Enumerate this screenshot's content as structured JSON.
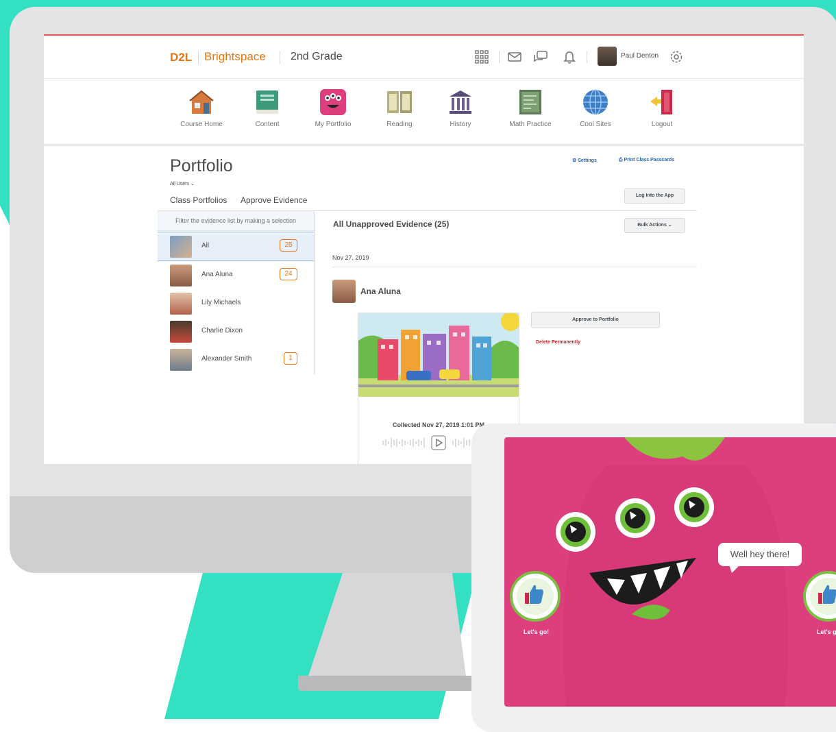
{
  "header": {
    "logo_d2l": "D2L",
    "logo_brightspace": "Brightspace",
    "course_name": "2nd Grade",
    "user_name": "Paul Denton",
    "icons": [
      "grid-icon",
      "mail-icon",
      "chat-icon",
      "bell-icon",
      "gear-icon"
    ]
  },
  "nav": {
    "items": [
      {
        "label": "Course Home",
        "icon": "house-icon"
      },
      {
        "label": "Content",
        "icon": "book-icon"
      },
      {
        "label": "My Portfolio",
        "icon": "monster-icon"
      },
      {
        "label": "Reading",
        "icon": "open-book-icon"
      },
      {
        "label": "History",
        "icon": "museum-icon"
      },
      {
        "label": "Math Practice",
        "icon": "chalkboard-icon"
      },
      {
        "label": "Cool Sites",
        "icon": "globe-icon"
      },
      {
        "label": "Logout",
        "icon": "door-icon"
      }
    ]
  },
  "page": {
    "title": "Portfolio",
    "user_filter": "All Users",
    "settings_link": "Settings",
    "print_link": "Print Class Passcards",
    "tabs": [
      "Class Portfolios",
      "Approve Evidence"
    ],
    "login_button": "Log Into the App"
  },
  "filter": {
    "heading": "Filter the evidence list by making a selection",
    "items": [
      {
        "name": "All",
        "count": "25",
        "selected": true
      },
      {
        "name": "Ana Aluna",
        "count": "24"
      },
      {
        "name": "Lily Michaels",
        "count": ""
      },
      {
        "name": "Charlie Dixon",
        "count": ""
      },
      {
        "name": "Alexander Smith",
        "count": "1"
      }
    ]
  },
  "evidence": {
    "title": "All Unapproved Evidence (25)",
    "bulk_actions": "Bulk Actions",
    "date": "Nov 27, 2019",
    "student": "Ana Aluna",
    "collected": "Collected Nov 27, 2019 1:01 PM",
    "approve_button": "Approve to Portfolio",
    "delete_link": "Delete Permanently"
  },
  "tablet": {
    "speech": "Well hey there!",
    "lets_go_left": "Let's go!",
    "lets_go_right": "Let's g"
  },
  "colors": {
    "brand_orange": "#e87511",
    "accent_red": "#e4554a",
    "teal_background": "#33e0c1",
    "tablet_pink": "#dd3f7e",
    "monster_green": "#7bc043"
  }
}
